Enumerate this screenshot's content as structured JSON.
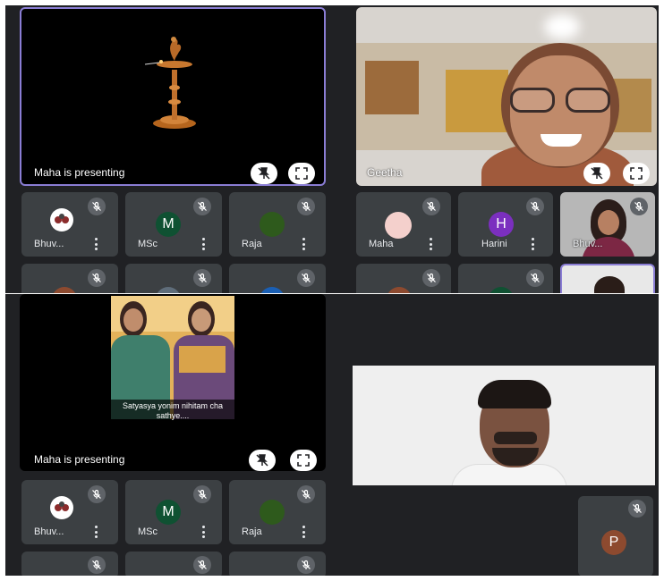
{
  "top_left": {
    "presenting_label": "Maha is presenting",
    "tiles": [
      {
        "name": "Bhuv...",
        "avatar_letter": "",
        "avatar_color": "#ffffff"
      },
      {
        "name": "MSc",
        "avatar_letter": "M",
        "avatar_color": "#0f5132"
      },
      {
        "name": "Raja",
        "avatar_letter": "",
        "avatar_color": "#2e5a1c"
      }
    ]
  },
  "top_right": {
    "speaker_name": "Geetha",
    "tiles": [
      {
        "name": "Maha",
        "avatar_letter": "",
        "avatar_color": "#f4d0cc"
      },
      {
        "name": "Harini",
        "avatar_letter": "H",
        "avatar_color": "#7b2fbf"
      },
      {
        "name": "Bhuv...",
        "avatar_letter": "",
        "avatar_color": "#b08090"
      }
    ]
  },
  "bottom_left": {
    "presenting_label": "Maha is presenting",
    "caption": "Satyasya yonim nihitam cha sathye....",
    "tiles": [
      {
        "name": "Bhuv...",
        "avatar_letter": "",
        "avatar_color": "#ffffff"
      },
      {
        "name": "MSc",
        "avatar_letter": "M",
        "avatar_color": "#0f5132"
      },
      {
        "name": "Raja",
        "avatar_letter": "",
        "avatar_color": "#2e5a1c"
      }
    ]
  },
  "bottom_right": {
    "tile": {
      "name": "",
      "avatar_letter": "P",
      "avatar_color": "#8d4a2f"
    }
  },
  "icons": {
    "mic_off": "mic-off-icon",
    "more": "more-vert-icon",
    "unpin": "unpin-icon",
    "fullscreen": "fullscreen-icon"
  },
  "colors": {
    "meet_bg": "#202124",
    "tile_bg": "#3c4043",
    "presenter_border": "#8a7dd4"
  }
}
